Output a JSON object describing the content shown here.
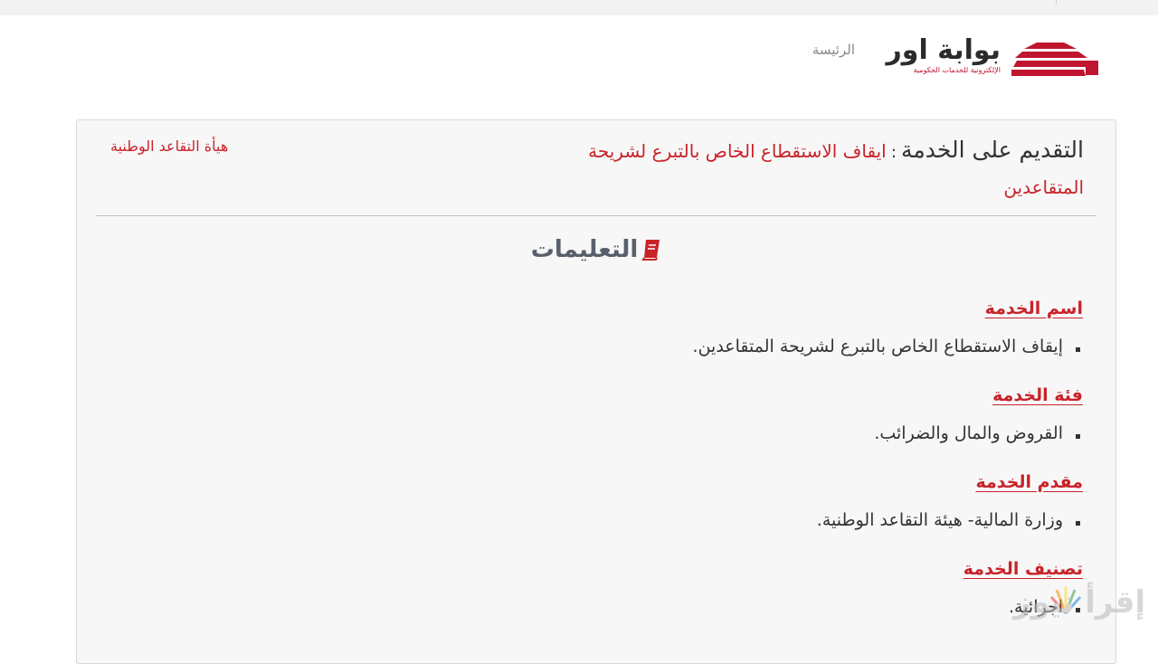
{
  "header": {
    "logo_name": "بوابة اور",
    "logo_subtitle": "الإلكترونية للخدمات الحكومية",
    "nav_home": "الرئيسة"
  },
  "page": {
    "title_prefix": "التقديم على الخدمة",
    "title_separator": ":",
    "service_name": "ايقاف الاستقطاع الخاص بالتبرع لشريحة المتقاعدين",
    "agency": "هيأة التقاعد الوطنية",
    "instructions_title": "التعليمات"
  },
  "sections": [
    {
      "title": "اسم الخدمة",
      "item": "إيقاف الاستقطاع الخاص بالتبرع لشريحة المتقاعدين."
    },
    {
      "title": "فئة الخدمة",
      "item": "القروض والمال والضرائب."
    },
    {
      "title": "مقدم الخدمة",
      "item": "وزارة المالية- هيئة التقاعد الوطنية."
    },
    {
      "title": "تصنيف الخدمة",
      "item": "اجرائية."
    }
  ],
  "watermark": {
    "text": "إقرأ نيوز"
  },
  "colors": {
    "accent": "#c9232a",
    "brand": "#c0152f",
    "heading": "#58606b"
  }
}
